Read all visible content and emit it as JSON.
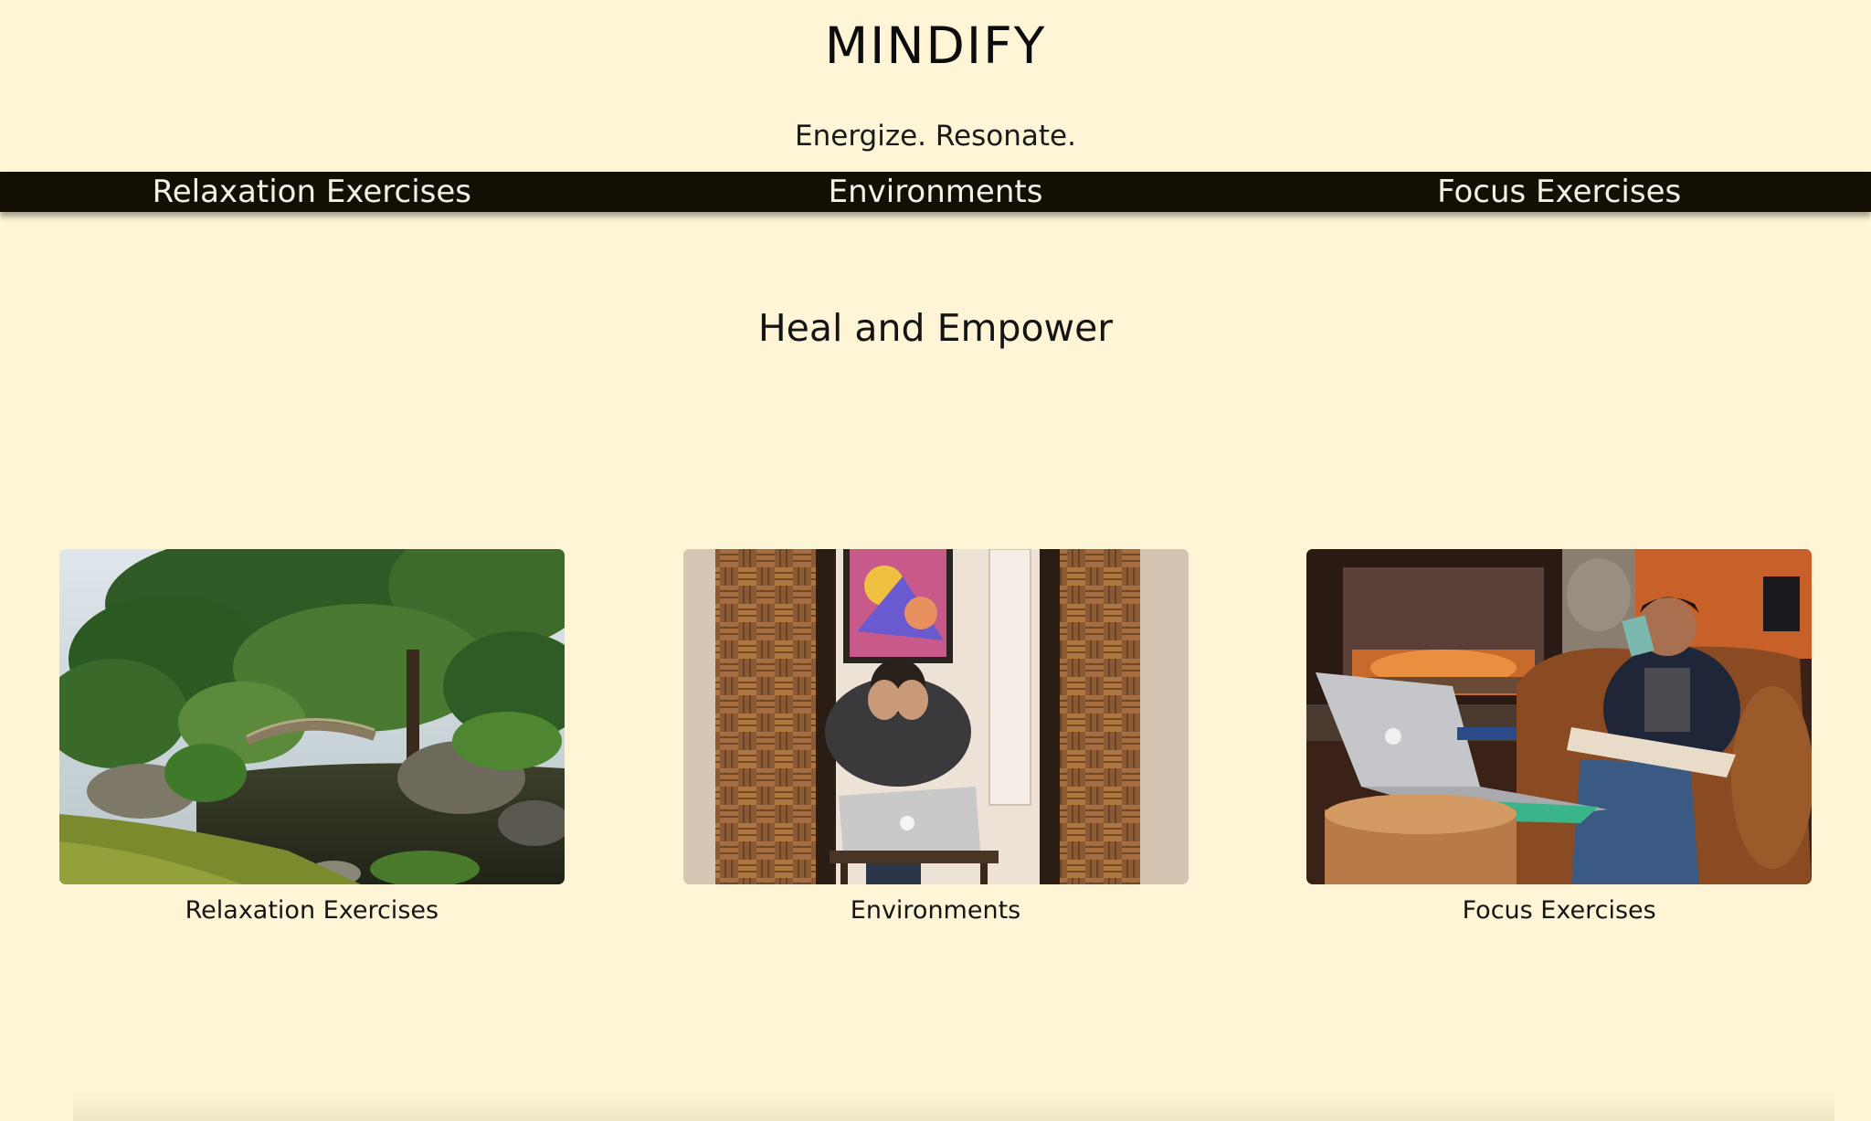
{
  "header": {
    "title": "MINDIFY",
    "tagline": "Energize. Resonate."
  },
  "nav": {
    "items": [
      {
        "label": "Relaxation Exercises"
      },
      {
        "label": "Environments"
      },
      {
        "label": "Focus Exercises"
      }
    ]
  },
  "main": {
    "heading": "Heal and Empower",
    "cards": [
      {
        "label": "Relaxation Exercises",
        "image": "japanese-garden-bridge-photo"
      },
      {
        "label": "Environments",
        "image": "man-stressed-at-laptop-photo"
      },
      {
        "label": "Focus Exercises",
        "image": "man-drinking-coffee-with-laptop-photo"
      }
    ]
  },
  "colors": {
    "background": "#fdf5d6",
    "navbar": "#130f04",
    "nav_text": "#f4f1e6"
  }
}
